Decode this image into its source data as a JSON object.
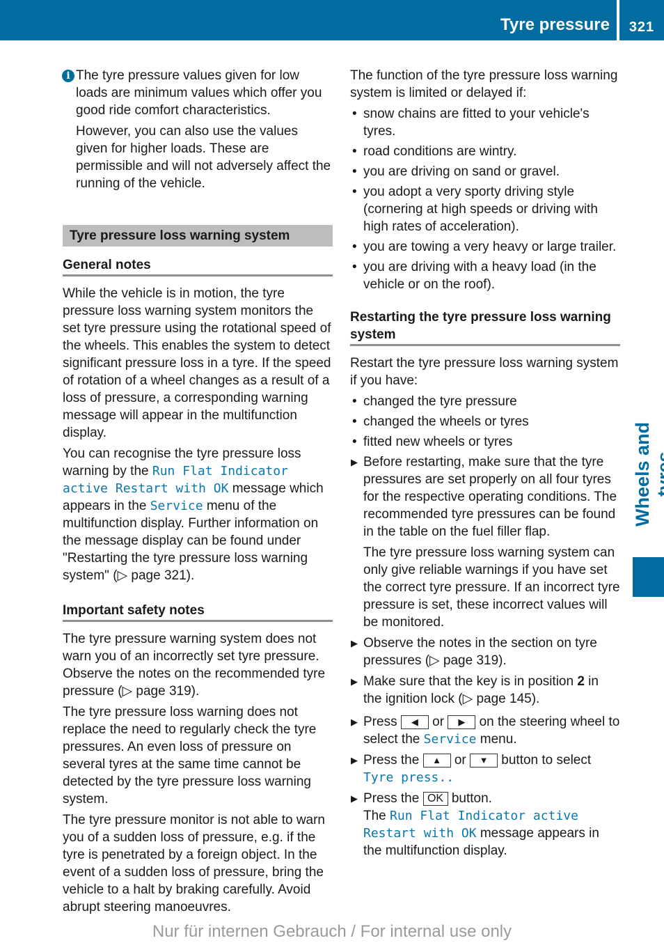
{
  "header": {
    "section_title": "Tyre pressure",
    "page_number": "321",
    "side_tab": "Wheels and tyres",
    "accent_color": "#006ca0"
  },
  "left": {
    "info": {
      "icon": "info-icon",
      "p1": "The tyre pressure values given for low loads are minimum values which offer you good ride comfort characteristics.",
      "p2": "However, you can also use the values given for higher loads. These are permissible and will not adversely affect the running of the vehicle."
    },
    "main_heading": "Tyre pressure loss warning system",
    "general": {
      "heading": "General notes",
      "p1": "While the vehicle is in motion, the tyre pressure loss warning system monitors the set tyre pressure using the rotational speed of the wheels. This enables the system to detect significant pressure loss in a tyre. If the speed of rotation of a wheel changes as a result of a loss of pressure, a corresponding warning message will appear in the multifunction display.",
      "p2_a": "You can recognise the tyre pressure loss warning by the ",
      "p2_msg": "Run Flat Indicator active Restart with OK",
      "p2_b": " message which appears in the ",
      "p2_menu": "Service",
      "p2_c": " menu of the multifunction display. Further information on the message display can be found under \"Restarting the tyre pressure loss warning system\" (▷ page 321)."
    },
    "safety": {
      "heading": "Important safety notes",
      "p1": "The tyre pressure warning system does not warn you of an incorrectly set tyre pressure. Observe the notes on the recommended tyre pressure (▷ page 319).",
      "p2": "The tyre pressure loss warning does not replace the need to regularly check the tyre pressures. An even loss of pressure on several tyres at the same time cannot be detected by the tyre pressure loss warning system.",
      "p3": "The tyre pressure monitor is not able to warn you of a sudden loss of pressure, e.g. if the tyre is penetrated by a foreign object. In the event of a sudden loss of pressure, bring the vehicle to a halt by braking carefully. Avoid abrupt steering manoeuvres."
    }
  },
  "right": {
    "limited_intro": "The function of the tyre pressure loss warning system is limited or delayed if:",
    "limited_items": [
      "snow chains are fitted to your vehicle's tyres.",
      "road conditions are wintry.",
      "you are driving on sand or gravel.",
      "you adopt a very sporty driving style (cornering at high speeds or driving with high rates of acceleration).",
      "you are towing a very heavy or large trailer.",
      "you are driving with a heavy load (in the vehicle or on the roof)."
    ],
    "restart": {
      "heading": "Restarting the tyre pressure loss warning system",
      "intro": "Restart the tyre pressure loss warning system if you have:",
      "items": [
        "changed the tyre pressure",
        "changed the wheels or tyres",
        "fitted new wheels or tyres"
      ],
      "step1": "Before restarting, make sure that the tyre pressures are set properly on all four tyres for the respective operating conditions. The recommended tyre pressures can be found in the table on the fuel filler flap.",
      "step1_note": "The tyre pressure loss warning system can only give reliable warnings if you have set the correct tyre pressure. If an incorrect tyre pressure is set, these incorrect values will be monitored.",
      "step2": "Observe the notes in the section on tyre pressures (▷ page 319).",
      "step3_a": "Make sure that the key is in position ",
      "step3_pos": "2",
      "step3_b": " in the ignition lock (▷ page 145).",
      "step4_a": "Press ",
      "step4_key1": "◀",
      "step4_or": " or ",
      "step4_key2": "▶",
      "step4_b": " on the steering wheel to select the ",
      "step4_menu": "Service",
      "step4_c": " menu.",
      "step5_a": "Press the ",
      "step5_key1": "▲",
      "step5_or": " or ",
      "step5_key2": "▼",
      "step5_b": " button to select ",
      "step5_item": "Tyre press..",
      "step6_a": "Press the ",
      "step6_key": "OK",
      "step6_b": " button.",
      "step6_c": "The ",
      "step6_msg": "Run Flat Indicator active Restart with OK",
      "step6_d": " message appears in the multifunction display."
    }
  },
  "footer": {
    "watermark": "Nur für internen Gebrauch / For internal use only"
  }
}
